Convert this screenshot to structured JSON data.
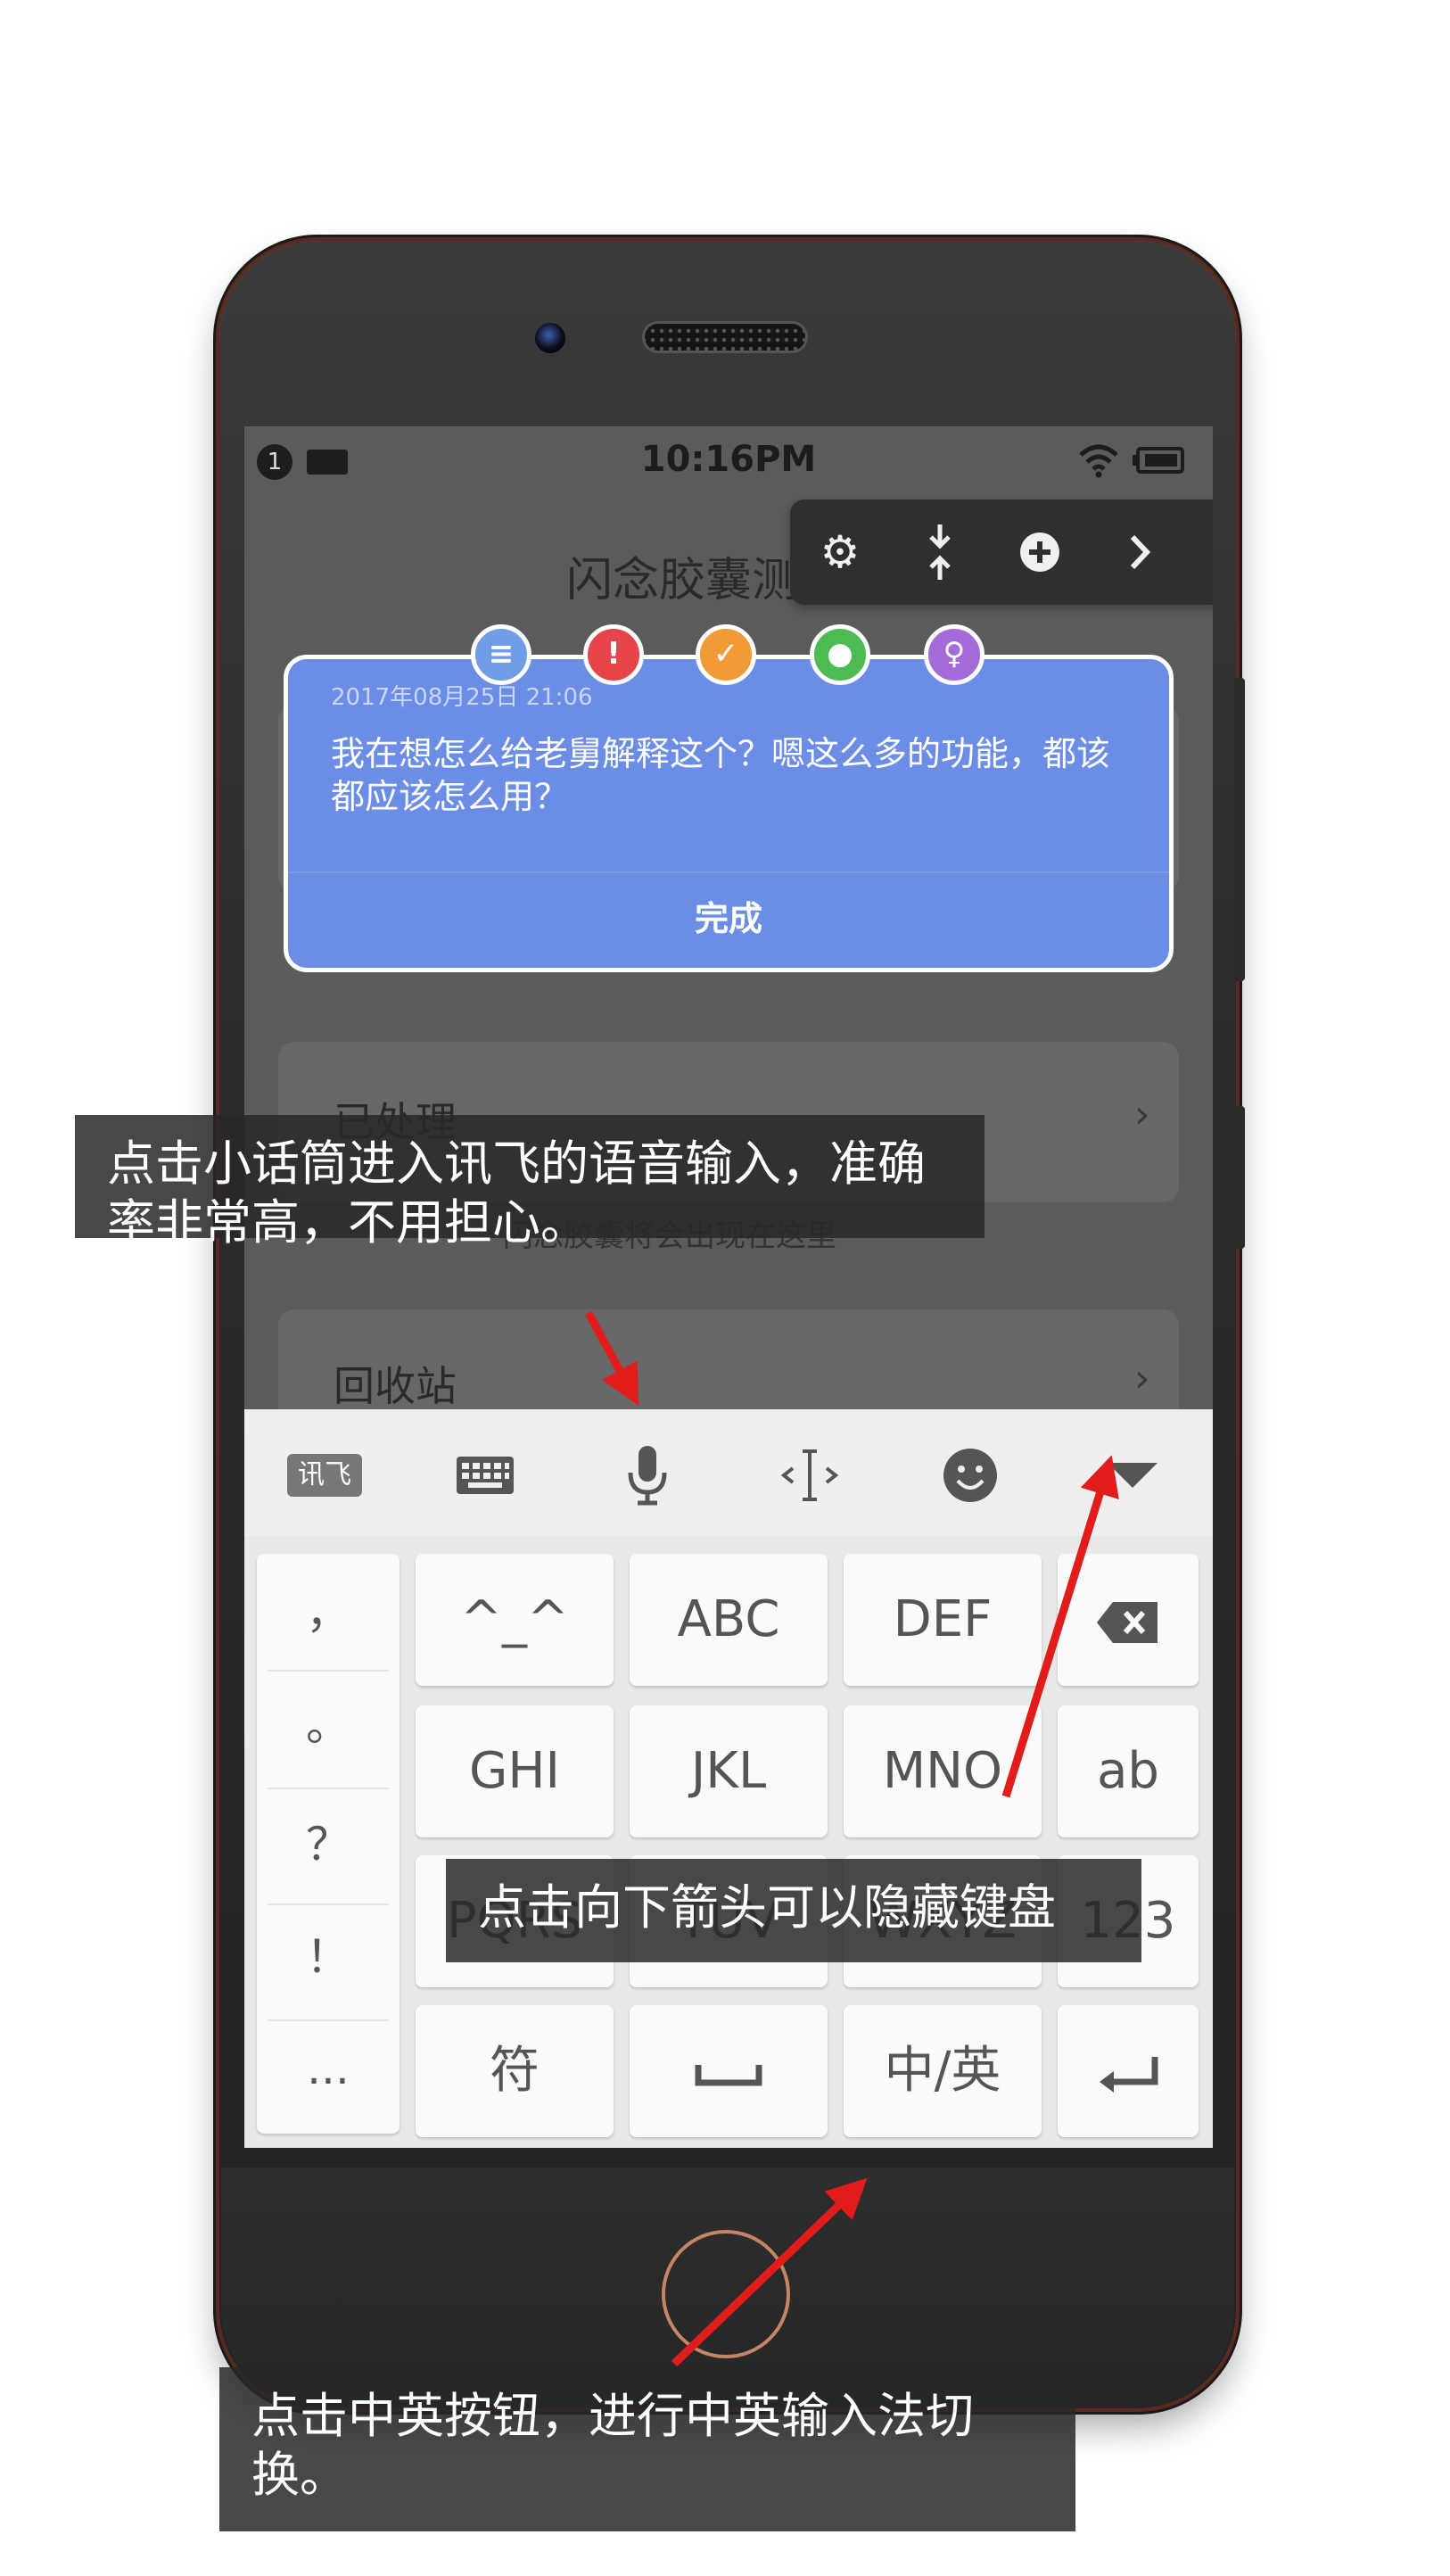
{
  "status_bar": {
    "notification_count": "1",
    "time": "10:16PM"
  },
  "app": {
    "title": "闪念胶囊测试版"
  },
  "floating_toolbar": {
    "icons": [
      "gear-icon",
      "collapse-icon",
      "plus-icon",
      "chevron-right-icon"
    ]
  },
  "note": {
    "date": "2017年08月25日 21:06",
    "text": "我在想怎么给老舅解释这个？嗯这么多的功能，都该都应该怎么用？",
    "done_label": "完成",
    "tags": [
      "document-icon",
      "exclamation-icon",
      "checklist-icon",
      "chat-icon",
      "bulb-icon"
    ],
    "tag_colors": [
      "#6f9ee6",
      "#e5444a",
      "#f29a35",
      "#4dbb54",
      "#a36ad8"
    ]
  },
  "lists": [
    {
      "label": "已处理"
    },
    {
      "label": "回收站"
    }
  ],
  "empty_hint": "闪念胶囊将会出现在这里",
  "keyboard": {
    "toolbar": {
      "brand_label": "讯飞",
      "icons": [
        "keyboard-icon",
        "microphone-icon",
        "cursor-icon",
        "emoji-icon",
        "hide-keyboard-icon"
      ]
    },
    "punctuation": [
      "，",
      "。",
      "？",
      "！",
      "..."
    ],
    "rows": [
      [
        "^_^",
        "ABC",
        "DEF",
        "⌫"
      ],
      [
        "GHI",
        "JKL",
        "MNO",
        "ab"
      ],
      [
        "PQRS",
        "TUV",
        "WXYZ",
        "123"
      ],
      [
        "符",
        "␣",
        "中/英",
        "↵"
      ]
    ]
  },
  "annotations": {
    "mic": "点击小话筒进入讯飞的语音输入，准确率非常高，不用担心。",
    "hide": "点击向下箭头可以隐藏键盘",
    "lang": "点击中英按钮，进行中英输入法切换。"
  },
  "colors": {
    "accent_arrow": "#e21b1b",
    "note_blue": "#6b8de6"
  }
}
